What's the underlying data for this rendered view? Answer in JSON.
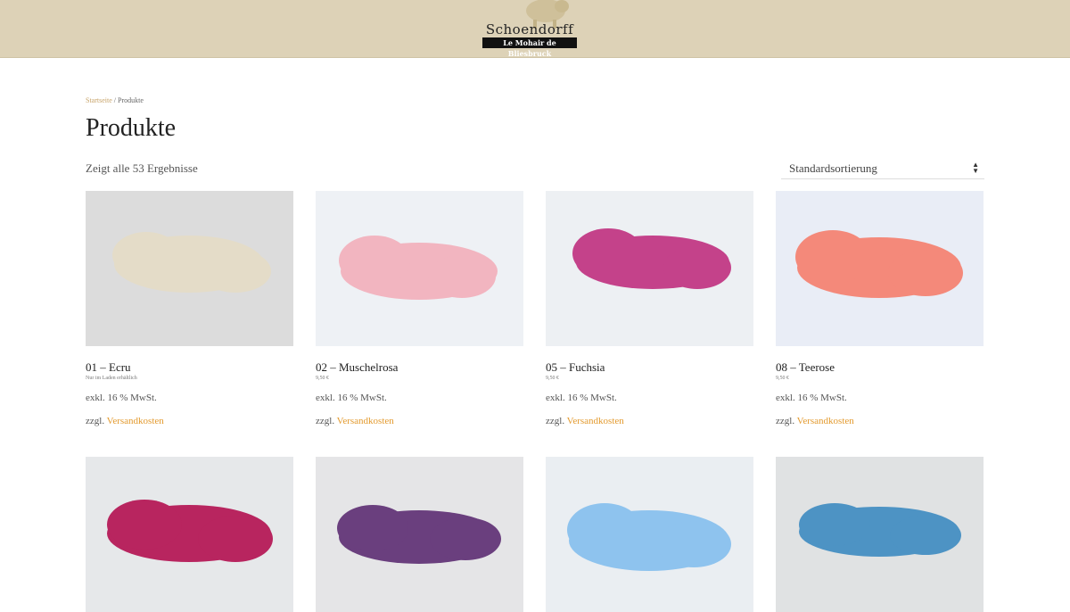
{
  "header": {
    "logo_name": "Schoendorff",
    "logo_tagline": "Le Mohair de Bliesbruck",
    "bg_color": "#ddd2b7"
  },
  "breadcrumb": {
    "home": "Startseite",
    "separator": " / ",
    "current": "Produkte"
  },
  "page": {
    "title": "Produkte",
    "result_count": "Zeigt alle 53 Ergebnisse"
  },
  "sort": {
    "selected": "Standardsortierung",
    "arrow_icon": "sort-arrows-icon"
  },
  "products": [
    {
      "name": "01 – Ecru",
      "sub": "Nur im Laden erhältlich",
      "tax": "exkl. 16 % MwSt.",
      "ship_prefix": "zzgl. ",
      "ship_link": "Versandkosten",
      "color": "#e4dcc8",
      "bg": "#dcdcdc"
    },
    {
      "name": "02 – Muschelrosa",
      "sub": "9,50 €",
      "tax": "exkl. 16 % MwSt.",
      "ship_prefix": "zzgl. ",
      "ship_link": "Versandkosten",
      "color": "#f2b5c0",
      "bg": "#eef1f5"
    },
    {
      "name": "05 – Fuchsia",
      "sub": "9,50 €",
      "tax": "exkl. 16 % MwSt.",
      "ship_prefix": "zzgl. ",
      "ship_link": "Versandkosten",
      "color": "#c4428a",
      "bg": "#edf0f3"
    },
    {
      "name": "08 – Teerose",
      "sub": "9,50 €",
      "tax": "exkl. 16 % MwSt.",
      "ship_prefix": "zzgl. ",
      "ship_link": "Versandkosten",
      "color": "#f4897a",
      "bg": "#e9edf6"
    },
    {
      "color": "#b8255f",
      "bg": "#e6e8ea"
    },
    {
      "color": "#6a3f7e",
      "bg": "#e5e5e7"
    },
    {
      "color": "#8ec3ee",
      "bg": "#eaeef2"
    },
    {
      "color": "#4d93c4",
      "bg": "#e0e2e3"
    }
  ]
}
